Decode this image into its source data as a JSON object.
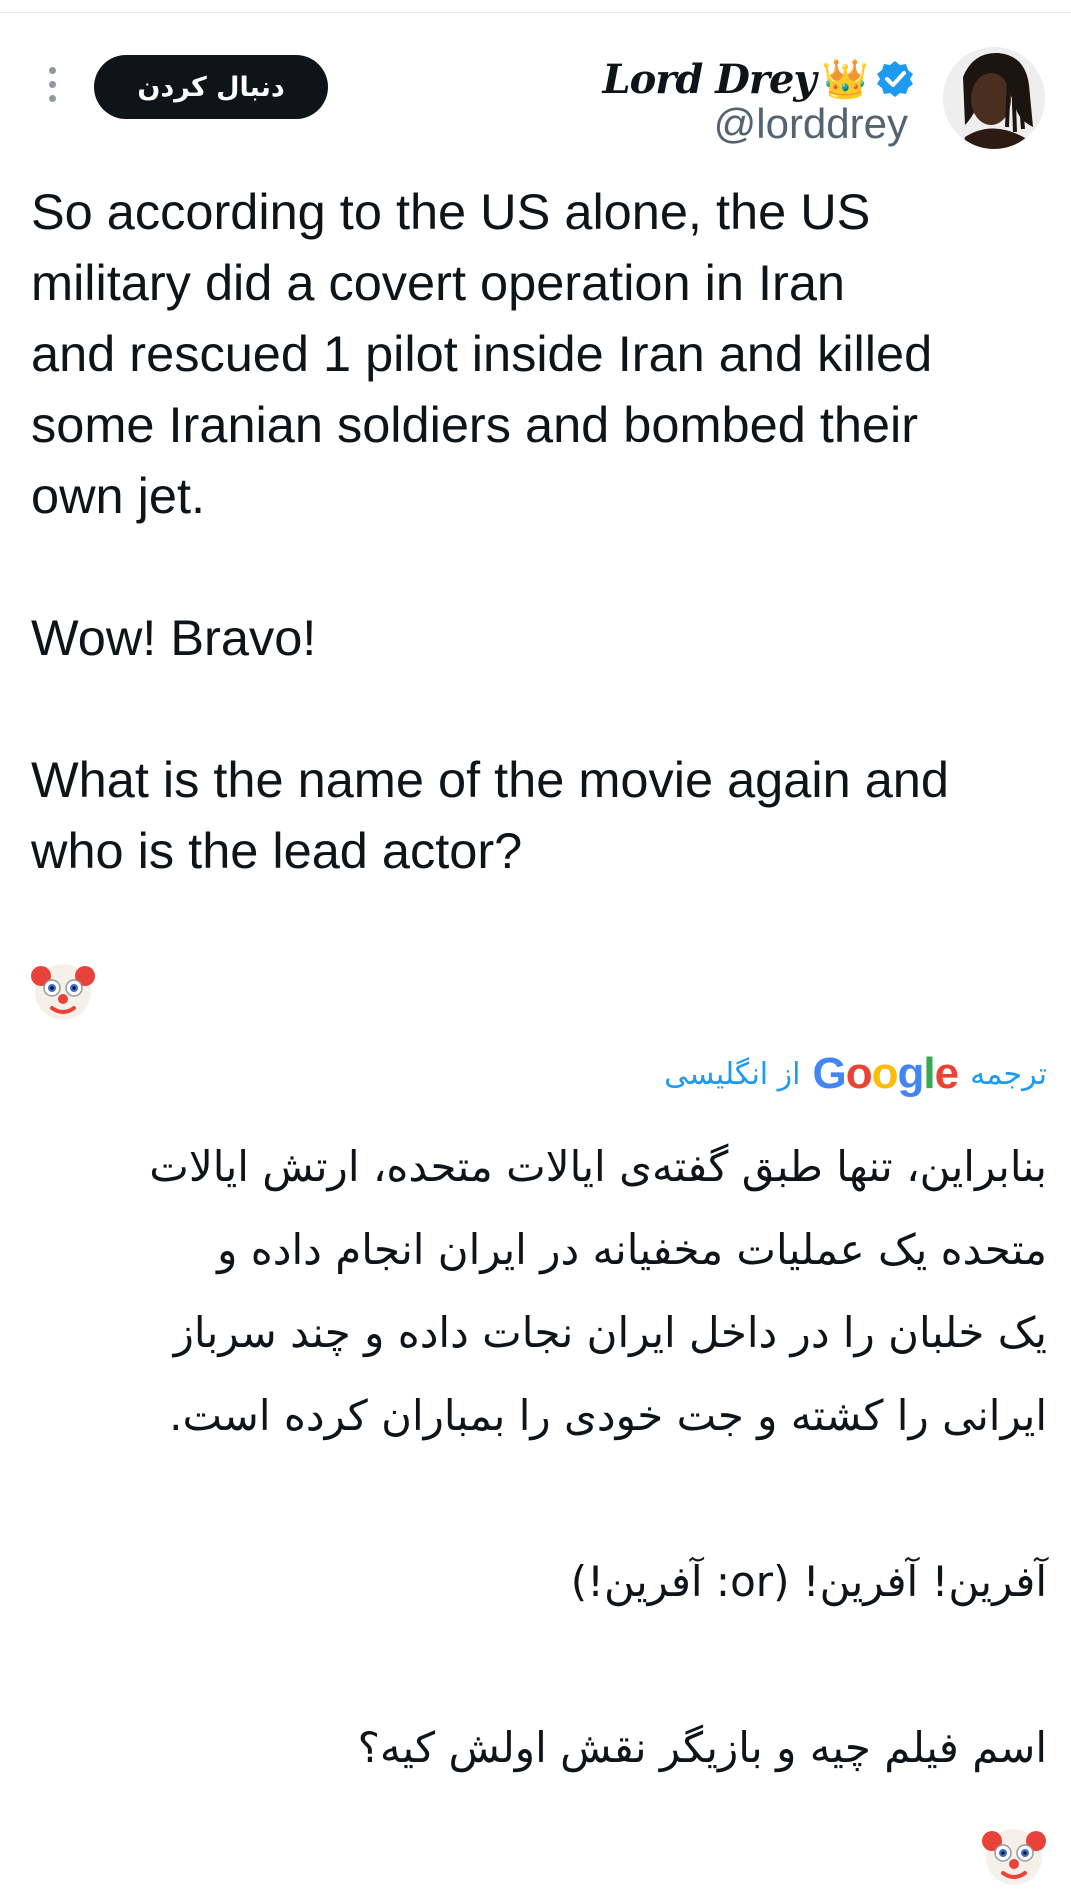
{
  "header": {
    "display_name": "Lord Drey",
    "crown_emoji": "👑",
    "handle": "@lorddrey",
    "follow_label": "دنبال کردن",
    "more_icon": "more-vertical-icon",
    "verified_icon": "verified-badge-icon",
    "verified_color": "#1d9bf0"
  },
  "tweet": {
    "text": "So according to the US alone, the US\nmilitary did a covert operation in Iran\nand rescued 1 pilot inside Iran and killed\nsome Iranian soldiers and bombed their\nown jet.\n\nWow! Bravo!\n\nWhat is the name of the movie again and\nwho is the lead actor?",
    "emoji": "clown-face-emoji"
  },
  "translation": {
    "label_prefix": "ترجمه",
    "provider": "Google",
    "label_suffix": "از انگلیسی",
    "text": "بنابراین، تنها طبق گفته‌ی ایالات متحده، ارتش ایالات\nمتحده یک عملیات مخفیانه در ایران انجام داده و\nیک خلبان را در داخل ایران نجات داده و چند سرباز\nایرانی را کشته و جت خودی را بمباران کرده است.\n\nآفرین! آفرین! (or: آفرین!)\n\nاسم فیلم چیه و بازیگر نقش اولش کیه؟",
    "emoji": "clown-face-emoji",
    "link_color": "#1d9bf0"
  }
}
